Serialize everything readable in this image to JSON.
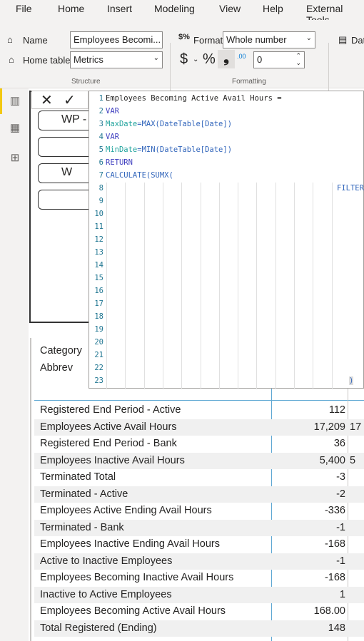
{
  "menu": [
    "File",
    "Home",
    "Insert",
    "Modeling",
    "View",
    "Help",
    "External Tools"
  ],
  "ribbon": {
    "name_label": "Name",
    "name_value": "Employees Becomi...",
    "home_table_label": "Home table",
    "home_table_value": "Metrics",
    "structure_label": "Structure",
    "format_label": "Format",
    "format_value": "Whole number",
    "currency_symbol": "$",
    "percent_symbol": "%",
    "comma_symbol": "❟",
    "decimal_symbol": ".00",
    "decimal_places": "0",
    "formatting_label": "Formatting",
    "data_category_label": "Dat"
  },
  "formula": {
    "lines": [
      {
        "n": "1",
        "html": "Employees Becoming Active Avail Hours ="
      },
      {
        "n": "2",
        "kw": "VAR"
      },
      {
        "n": "3",
        "var": "MaxDate",
        "rest": "=MAX(DateTable[Date])"
      },
      {
        "n": "4",
        "kw": "VAR"
      },
      {
        "n": "5",
        "var": "MinDate",
        "rest": "=MIN(DateTable[Date])"
      },
      {
        "n": "6",
        "kw": "RETURN"
      },
      {
        "n": "7",
        "fn": "CALCULATE(SUMX("
      },
      {
        "n": "8",
        "fn": "FILTER"
      },
      {
        "n": "9"
      },
      {
        "n": "10"
      },
      {
        "n": "11"
      },
      {
        "n": "12"
      },
      {
        "n": "13"
      },
      {
        "n": "14"
      },
      {
        "n": "15"
      },
      {
        "n": "16"
      },
      {
        "n": "17"
      },
      {
        "n": "18"
      },
      {
        "n": "19"
      },
      {
        "n": "20"
      },
      {
        "n": "21"
      },
      {
        "n": "22"
      },
      {
        "n": "23",
        "fn": ")"
      }
    ]
  },
  "slicers": [
    "WP -",
    "",
    "W",
    ""
  ],
  "category_header": "Category",
  "abbrev_header": "Abbrev",
  "table": {
    "rows": [
      [
        "Registered End Period - Active",
        "112",
        ""
      ],
      [
        "Employees Active Avail Hours",
        "17,209",
        "17"
      ],
      [
        "Registered End Period - Bank",
        "36",
        ""
      ],
      [
        "Employees Inactive Avail Hours",
        "5,400",
        "5"
      ],
      [
        "Terminated Total",
        "-3",
        ""
      ],
      [
        "Terminated - Active",
        "-2",
        ""
      ],
      [
        "Employees Active Ending Avail Hours",
        "-336",
        ""
      ],
      [
        "Terminated - Bank",
        "-1",
        ""
      ],
      [
        "Employees Inactive Ending Avail Hours",
        "-168",
        ""
      ],
      [
        "Active to Inactive Employees",
        "-1",
        ""
      ],
      [
        "Employees Becoming Inactive Avail Hours",
        "-168",
        ""
      ],
      [
        "Inactive to Active Employees",
        "1",
        ""
      ],
      [
        "Employees Becoming Active Avail Hours",
        "168.00",
        ""
      ],
      [
        "Total Registered (Ending)",
        "148",
        ""
      ]
    ]
  },
  "colors": {
    "accent": "#f2c811",
    "table_line": "#5fa8d3"
  }
}
